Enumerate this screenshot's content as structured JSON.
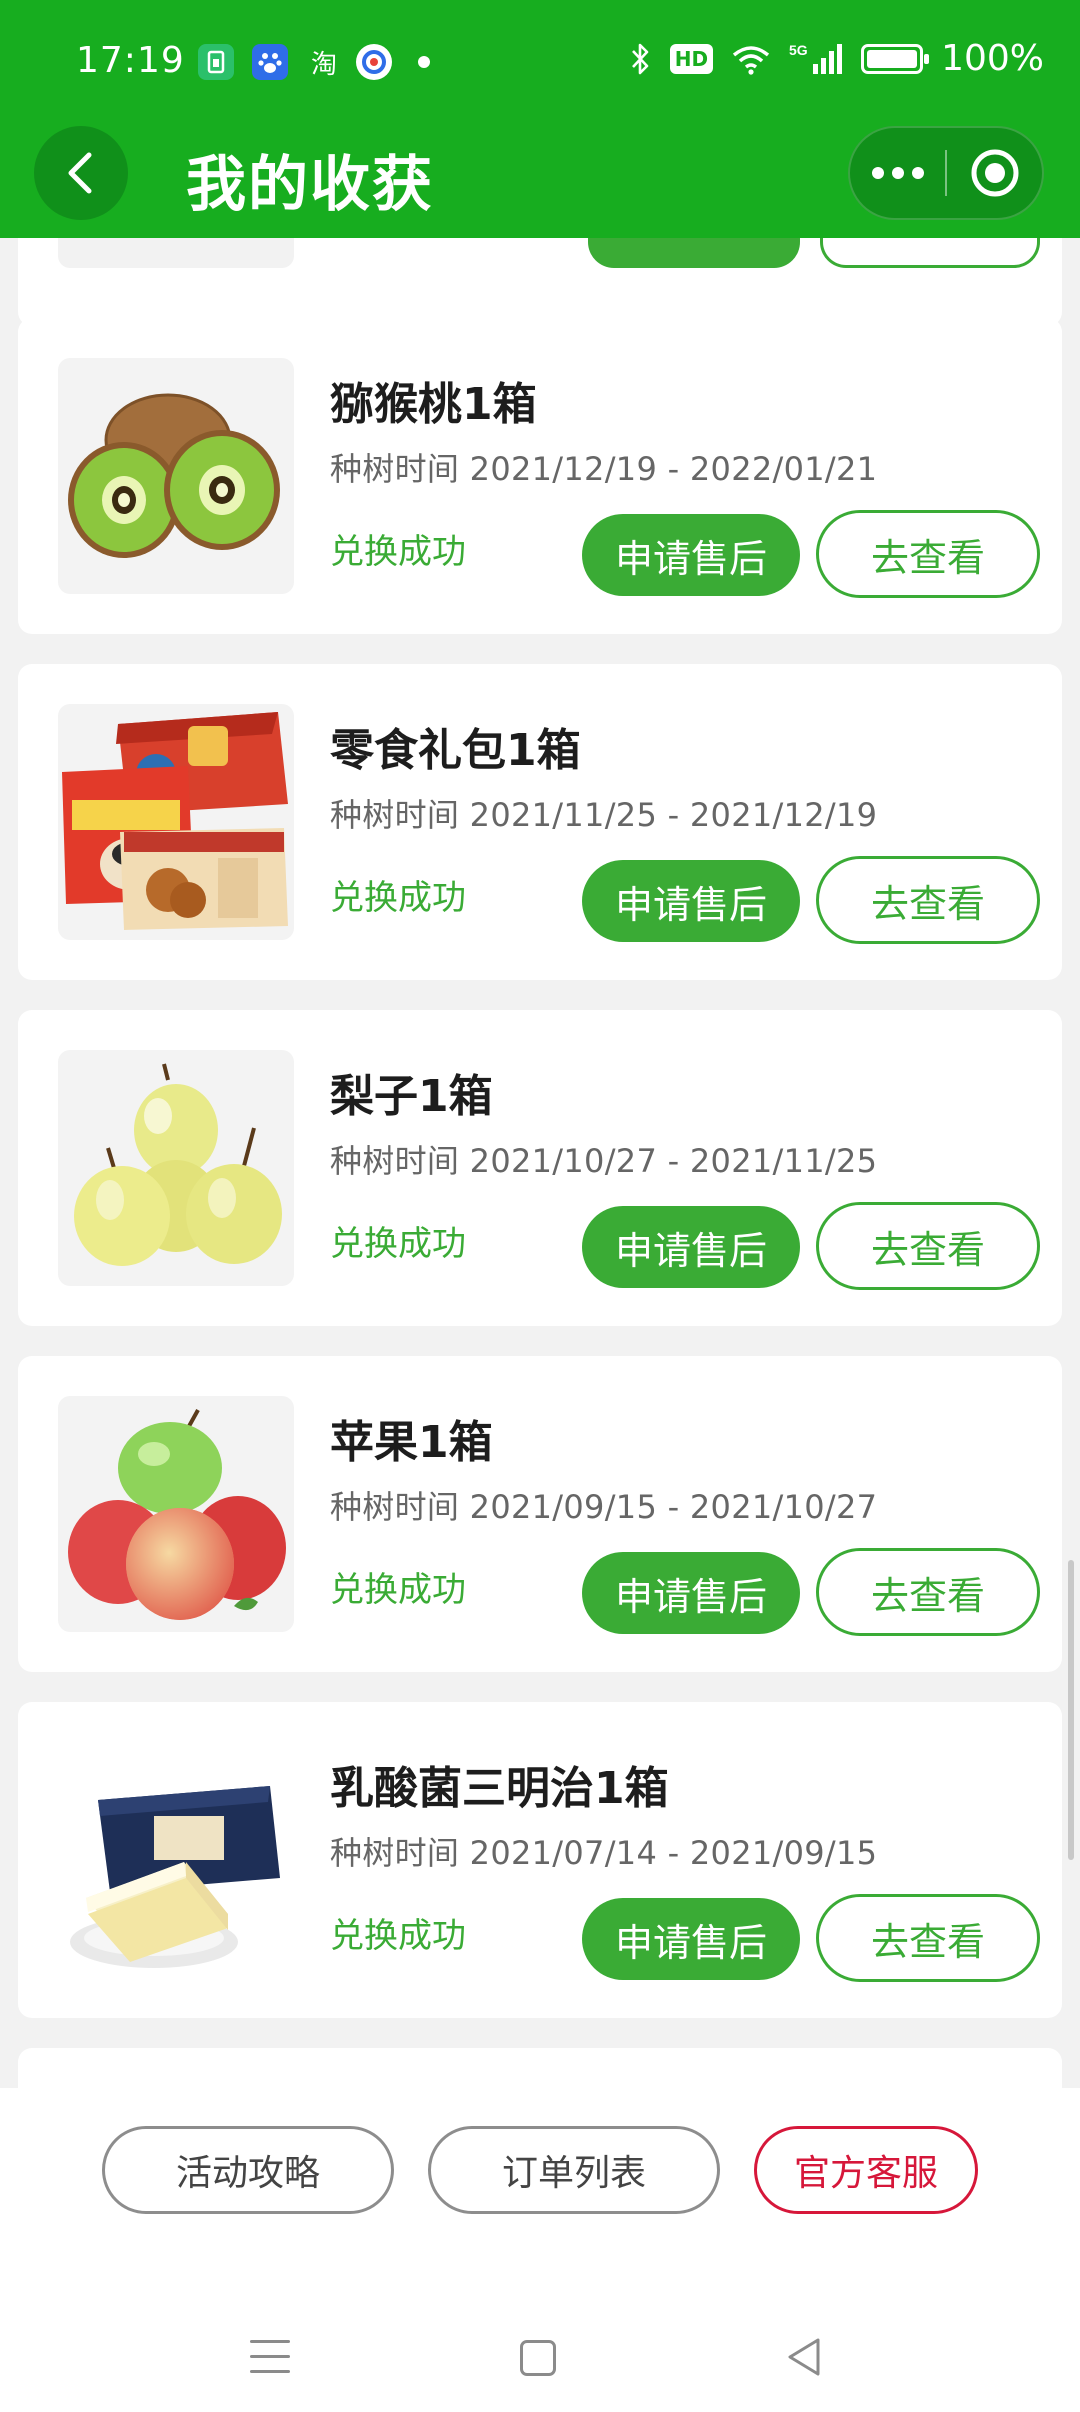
{
  "status_bar": {
    "time": "17:19",
    "battery": "100%",
    "network": "5G",
    "hd_label": "HD",
    "notification_app_label": "淘"
  },
  "nav": {
    "title": "我的收获"
  },
  "list": {
    "items": [
      {
        "title": "猕猴桃1箱",
        "date": "种树时间 2021/12/19 - 2022/01/21",
        "status": "兑换成功",
        "after_sale_label": "申请售后",
        "view_label": "去查看",
        "image": "kiwi"
      },
      {
        "title": "零食礼包1箱",
        "date": "种树时间 2021/11/25 - 2021/12/19",
        "status": "兑换成功",
        "after_sale_label": "申请售后",
        "view_label": "去查看",
        "image": "snack-box"
      },
      {
        "title": "梨子1箱",
        "date": "种树时间 2021/10/27 - 2021/11/25",
        "status": "兑换成功",
        "after_sale_label": "申请售后",
        "view_label": "去查看",
        "image": "pears"
      },
      {
        "title": "苹果1箱",
        "date": "种树时间 2021/09/15 - 2021/10/27",
        "status": "兑换成功",
        "after_sale_label": "申请售后",
        "view_label": "去查看",
        "image": "apples"
      },
      {
        "title": "乳酸菌三明治1箱",
        "date": "种树时间 2021/07/14 - 2021/09/15",
        "status": "兑换成功",
        "after_sale_label": "申请售后",
        "view_label": "去查看",
        "image": "sandwich-cake"
      }
    ]
  },
  "bottom_bar": {
    "guide_label": "活动攻略",
    "orders_label": "订单列表",
    "service_label": "官方客服"
  },
  "colors": {
    "brand_green": "#17ad1f",
    "accent_green": "#3aab35",
    "service_red": "#d6173a"
  }
}
